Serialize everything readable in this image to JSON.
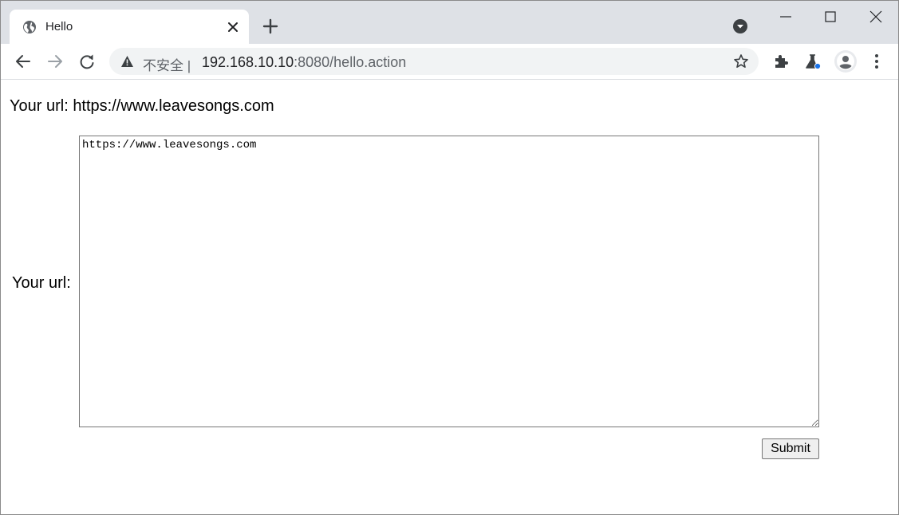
{
  "tab": {
    "title": "Hello",
    "favicon": "globe-icon"
  },
  "omnibox": {
    "security_label": "不安全",
    "separator": "|",
    "url_host": "192.168.10.10",
    "url_rest": ":8080/hello.action"
  },
  "page": {
    "display_label": "Your url: ",
    "display_value": "https://www.leavesongs.com",
    "field_label": "Your url:",
    "textarea_value": "https://www.leavesongs.com",
    "submit_label": "Submit"
  },
  "colors": {
    "tabstrip_bg": "#dee1e6",
    "omnibox_bg": "#f1f3f4",
    "extension_badge": "#1a73e8"
  }
}
